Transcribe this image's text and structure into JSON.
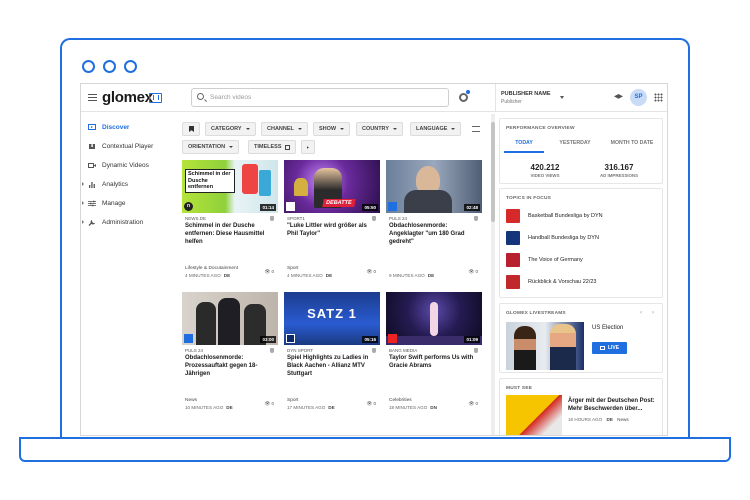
{
  "app": {
    "logo": "glomex",
    "search_placeholder": "Search videos",
    "publisher_name": "PUBLISHER NAME",
    "publisher_role": "Publisher",
    "avatar_initials": "SP",
    "accent_color": "#1f6fe0"
  },
  "sidebar": {
    "items": [
      {
        "label": "Discover",
        "icon": "play-screen-icon",
        "active": true
      },
      {
        "label": "Contextual Player",
        "icon": "puzzle-icon",
        "active": false
      },
      {
        "label": "Dynamic Videos",
        "icon": "video-icon",
        "active": false
      },
      {
        "label": "Analytics",
        "icon": "bar-chart-icon",
        "active": false
      },
      {
        "label": "Manage",
        "icon": "sliders-icon",
        "active": false
      },
      {
        "label": "Administration",
        "icon": "wrench-icon",
        "active": false
      }
    ]
  },
  "filters": {
    "category": "CATEGORY",
    "channel": "CHANNEL",
    "show": "SHOW",
    "country": "COUNTRY",
    "language": "LANGUAGE",
    "orientation": "ORIENTATION",
    "timeless": "TIMELESS"
  },
  "cards": [
    {
      "source": "NEWS.DE",
      "title": "Schimmel in der Dusche entfernen: Diese Hausmittel helfen",
      "category": "Lifestyle & Docutainment",
      "age": "4 MINUTES AGO",
      "lang": "DE",
      "views": "0",
      "duration": "01:14",
      "overlay": "Schimmel in der Dusche entfernen"
    },
    {
      "source": "SPORT1",
      "title": "\"Luke Littler wird größer als Phil Taylor\"",
      "category": "Sport",
      "age": "4 MINUTES AGO",
      "lang": "DE",
      "views": "0",
      "duration": "05:50",
      "overlay": "DEBATTE"
    },
    {
      "source": "PULS 24",
      "title": "Obdachlosenmorde: Angeklagter \"um 180 Grad gedreht\"",
      "category": "",
      "age": "9 MINUTES AGO",
      "lang": "DE",
      "views": "0",
      "duration": "02:48",
      "overlay": ""
    },
    {
      "source": "PULS 24",
      "title": "Obdachlosenmorde: Prozessauftakt gegen 18-Jährigen",
      "category": "News",
      "age": "10 MINUTES AGO",
      "lang": "DE",
      "views": "0",
      "duration": "03:00",
      "overlay": ""
    },
    {
      "source": "DYN SPORT",
      "title": "Spiel Highlights zu Ladies in Black Aachen - Allianz MTV Stuttgart",
      "category": "Sport",
      "age": "17 MINUTES AGO",
      "lang": "DE",
      "views": "0",
      "duration": "05:16",
      "overlay": "SATZ 1"
    },
    {
      "source": "BANG MEDIA",
      "title": "Taylor Swift performs Us with Gracie Abrams",
      "category": "Celebrities",
      "age": "18 MINUTES AGO",
      "lang": "DN",
      "views": "0",
      "duration": "01:09",
      "overlay": ""
    }
  ],
  "performance": {
    "title": "PERFORMANCE OVERVIEW",
    "tabs": [
      "TODAY",
      "YESTERDAY",
      "MONTH TO DATE"
    ],
    "video_views": "420.212",
    "video_views_label": "VIDEO VIEWS",
    "ad_impressions": "316.167",
    "ad_impressions_label": "AD IMPRESSIONS"
  },
  "topics": {
    "title": "TOPICS IN FOCUS",
    "items": [
      "Basketball Bundesliga by DYN",
      "Handball Bundesliga by DYN",
      "The Voice of Germany",
      "Rückblick & Vorschau 22/23"
    ]
  },
  "livestreams": {
    "title": "GLOMEX LIVESTREAMS",
    "item": "US Election",
    "button": "LIVE"
  },
  "mustsee": {
    "title": "MUST SEE",
    "item_title": "Ärger mit der Deutschen Post: Mehr Beschwerden über...",
    "age": "16 HOURS AGO",
    "lang": "DE",
    "category": "News"
  }
}
